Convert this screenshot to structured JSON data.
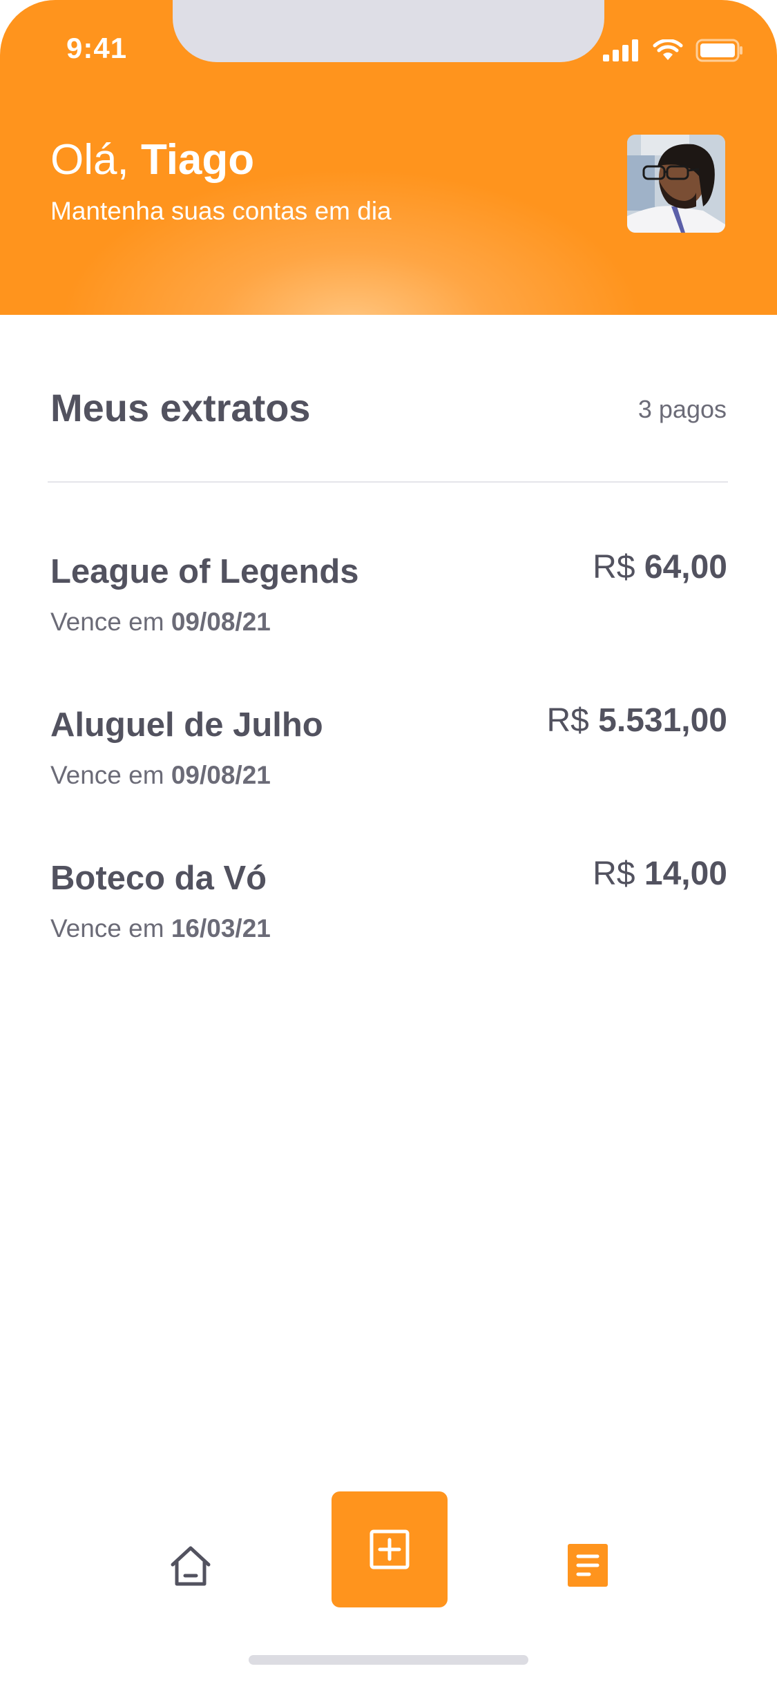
{
  "status_bar": {
    "time": "9:41",
    "icons": [
      "signal-icon",
      "wifi-icon",
      "battery-icon"
    ]
  },
  "header": {
    "greeting_prefix": "Olá, ",
    "user_name": "Tiago",
    "subtitle": "Mantenha suas contas em dia",
    "avatar_alt": "avatar"
  },
  "section": {
    "title": "Meus extratos",
    "paid_count": "3 pagos"
  },
  "bills": [
    {
      "title": "League of Legends",
      "due_prefix": "Vence em ",
      "due_date": "09/08/21",
      "currency": "R$ ",
      "amount": "64,00"
    },
    {
      "title": "Aluguel de Julho",
      "due_prefix": "Vence em ",
      "due_date": "09/08/21",
      "currency": "R$ ",
      "amount": "5.531,00"
    },
    {
      "title": "Boteco da Vó",
      "due_prefix": "Vence em ",
      "due_date": "16/03/21",
      "currency": "R$ ",
      "amount": "14,00"
    }
  ],
  "nav": {
    "items": [
      "home-icon",
      "add-icon",
      "statements-icon"
    ],
    "active": "statements"
  },
  "colors": {
    "accent": "#ff941d",
    "text_primary": "#52525f",
    "text_secondary": "#6b6b77",
    "divider": "#e4e4ea"
  }
}
